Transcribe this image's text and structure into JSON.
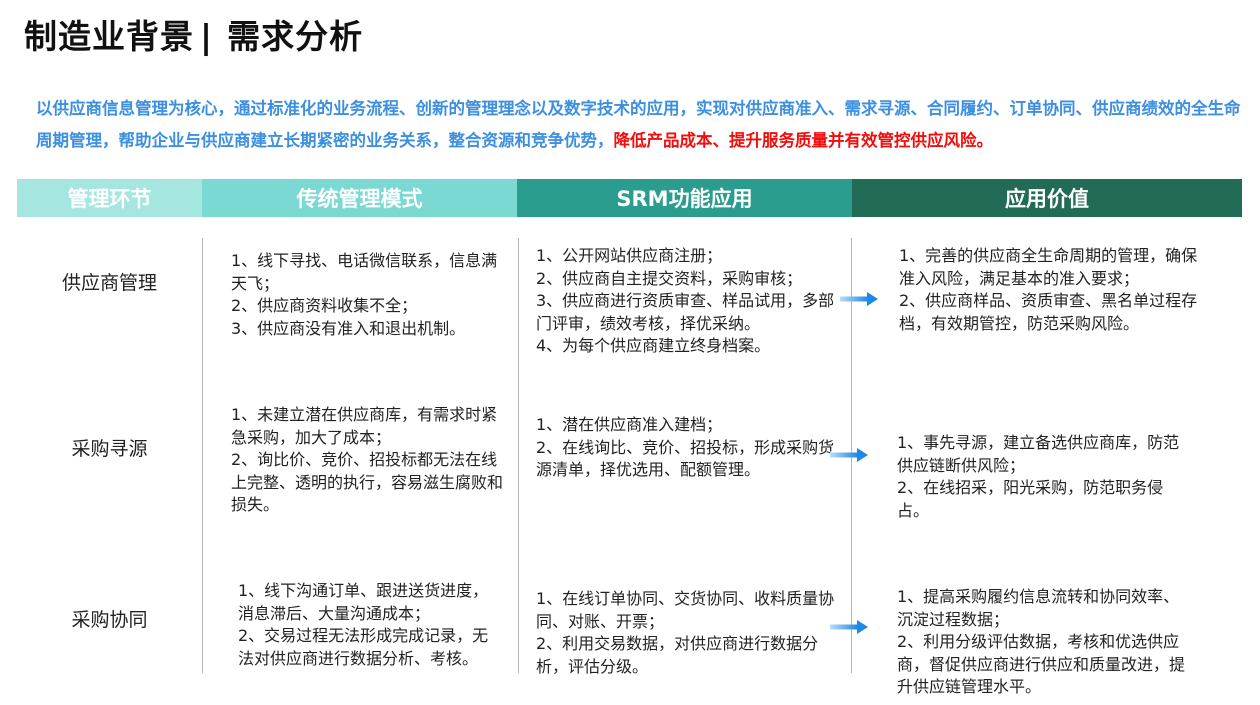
{
  "page": {
    "title": "制造业背景",
    "title_sep": "|",
    "title_sub": "需求分析"
  },
  "intro": {
    "text": "以供应商信息管理为核心，通过标准化的业务流程、创新的管理理念以及数字技术的应用，实现对供应商准入、需求寻源、合同履约、订单协同、供应商绩效的全生命周期管理，帮助企业与供应商建立长期紧密的业务关系，整合资源和竞争优势，",
    "highlight": "降低产品成本、提升服务质量并有效管控供应风险。"
  },
  "table": {
    "headers": [
      "管理环节",
      "传统管理模式",
      "SRM功能应用",
      "应用价值"
    ],
    "rows": [
      {
        "label": "供应商管理",
        "traditional": "1、线下寻找、电话微信联系，信息满天飞；\n2、供应商资料收集不全；\n3、供应商没有准入和退出机制。",
        "srm": "1、公开网站供应商注册；\n2、供应商自主提交资料，采购审核；\n3、供应商进行资质审查、样品试用，多部门评审，绩效考核，择优采纳。\n4、为每个供应商建立终身档案。",
        "value": "1、完善的供应商全生命周期的管理，确保准入风险，满足基本的准入要求；\n2、供应商样品、资质审查、黑名单过程存档，有效期管控，防范采购风险。"
      },
      {
        "label": "采购寻源",
        "traditional": "1、未建立潜在供应商库，有需求时紧急采购，加大了成本；\n2、询比价、竞价、招投标都无法在线上完整、透明的执行，容易滋生腐败和损失。",
        "srm": "1、潜在供应商准入建档；\n2、在线询比、竞价、招投标，形成采购货源清单，择优选用、配额管理。",
        "value": "1、事先寻源，建立备选供应商库，防范供应链断供风险；\n2、在线招采，阳光采购，防范职务侵占。"
      },
      {
        "label": "采购协同",
        "traditional": "1、线下沟通订单、跟进送货进度，消息滞后、大量沟通成本；\n2、交易过程无法形成完成记录，无法对供应商进行数据分析、考核。",
        "srm": "1、在线订单协同、交货协同、收料质量协同、对账、开票；\n2、利用交易数据，对供应商进行数据分析，评估分级。",
        "value": "1、提高采购履约信息流转和协同效率、沉淀过程数据；\n2、利用分级评估数据，考核和优选供应商，督促供应商进行供应和质量改进，提升供应链管理水平。"
      }
    ]
  },
  "icons": {
    "row_arrow": "arrow-right-icon"
  },
  "colors": {
    "intro": "#3d8fe0",
    "highlight": "#f20d0d",
    "header_1": "#a6e6e0",
    "header_2": "#7ad9d2",
    "header_3": "#2a9d8f",
    "header_4": "#226b57",
    "arrow": "#1e88e5"
  }
}
